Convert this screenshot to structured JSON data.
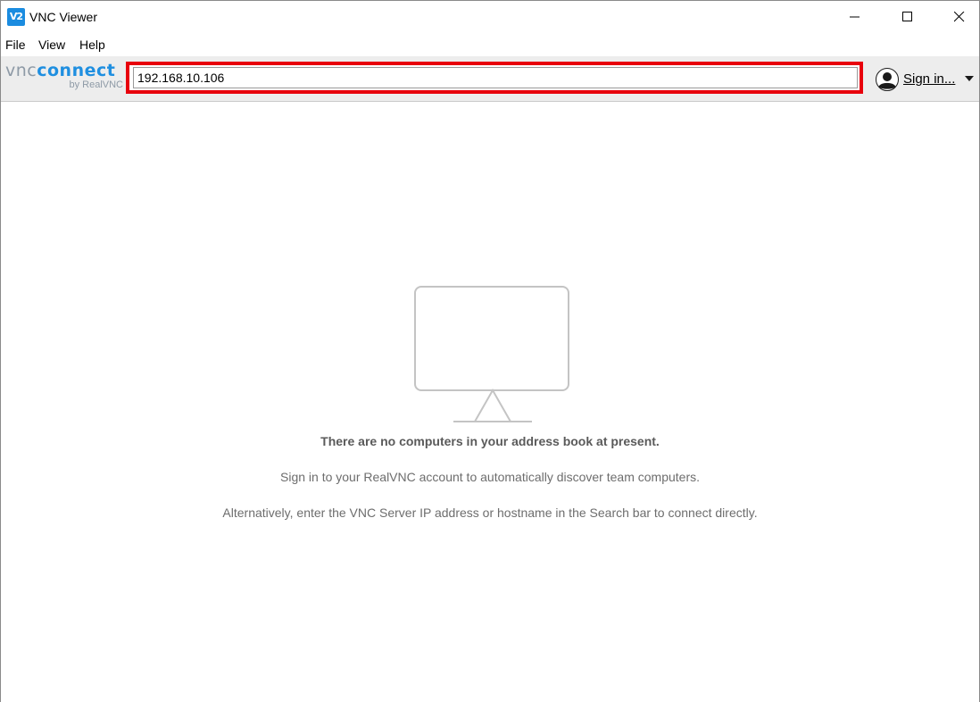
{
  "window": {
    "title": "VNC Viewer",
    "app_icon_text": "V2"
  },
  "menu": {
    "items": [
      {
        "label": "File"
      },
      {
        "label": "View"
      },
      {
        "label": "Help"
      }
    ]
  },
  "toolbar": {
    "logo_vnc": "vnc",
    "logo_connect": "connect",
    "logo_by": "by RealVNC",
    "search_value": "192.168.10.106",
    "search_highlight_color": "#e8000c",
    "signin_label": "Sign in...",
    "brand_color": "#1f8fe0"
  },
  "empty_state": {
    "heading": "There are no computers in your address book at present.",
    "line1": "Sign in to your RealVNC account to automatically discover team computers.",
    "line2": "Alternatively, enter the VNC Server IP address or hostname in the Search bar to connect directly.",
    "icon": "monitor-icon"
  }
}
